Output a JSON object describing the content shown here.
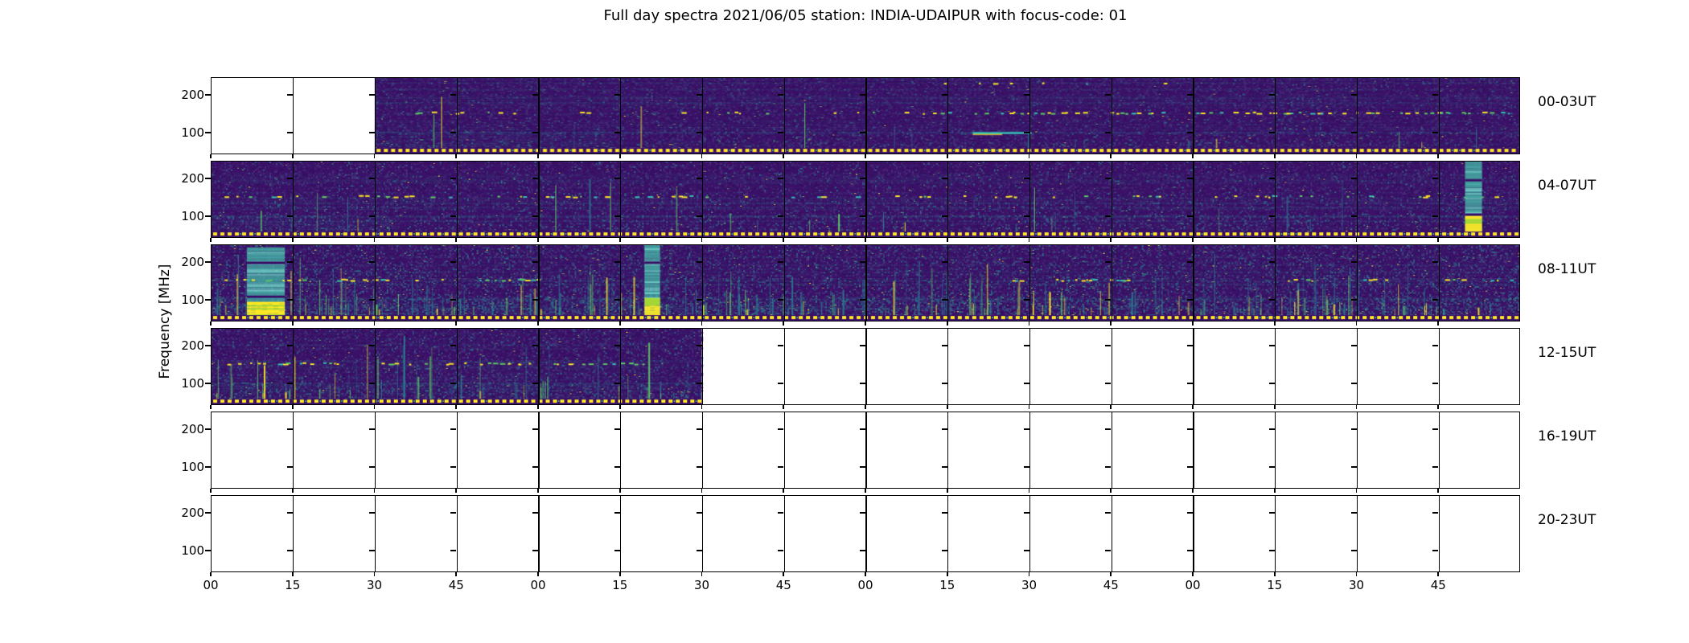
{
  "title": "Full day spectra 2021/06/05 station: INDIA-UDAIPUR with focus-code: 01",
  "ylabel": "Frequency [MHz]",
  "y_tick_labels": [
    "200",
    "100"
  ],
  "x_tick_labels": [
    "00",
    "15",
    "30",
    "45",
    "00",
    "15",
    "30",
    "45",
    "00",
    "15",
    "30",
    "45",
    "00",
    "15",
    "30",
    "45"
  ],
  "row_labels": [
    "00-03UT",
    "04-07UT",
    "08-11UT",
    "12-15UT",
    "16-19UT",
    "20-23UT"
  ],
  "chart_data": {
    "type": "heatmap",
    "subtype": "solar-radio-spectrogram",
    "title": "Full day spectra 2021/06/05 station: INDIA-UDAIPUR with focus-code: 01",
    "xlabel": "",
    "ylabel": "Frequency [MHz]",
    "colormap": "viridis",
    "y_ticks_mhz": [
      200,
      100
    ],
    "y_range_mhz_estimate": [
      45,
      255
    ],
    "panels_per_row": 16,
    "panel_minutes": 15,
    "x_tick_labels": [
      "00",
      "15",
      "30",
      "45",
      "00",
      "15",
      "30",
      "45",
      "00",
      "15",
      "30",
      "45",
      "00",
      "15",
      "30",
      "45"
    ],
    "legend": "none",
    "grid": "panel borders only",
    "colors": {
      "base": "#3b1069",
      "speckle_purple": "#46327e",
      "teal": "#2a788e",
      "bright_teal": "#35c0b5",
      "green": "#5ec962",
      "yellow": "#fde725",
      "band_teal": "#45a8a2",
      "band_light": "#6ccdc4",
      "green_yellow": "#addc30",
      "frame": "#000000",
      "empty": "#ffffff"
    },
    "rows": [
      {
        "label": "00-03UT",
        "fill_start_panel": 2,
        "fill_end_panel": 16,
        "noise": 0.035,
        "streaks": 15,
        "features": [
          {
            "type": "dash_line",
            "y": 0.455,
            "x0": 0.135,
            "x1": 0.53,
            "density": 0.22
          },
          {
            "type": "dash_line",
            "y": 0.455,
            "x0": 0.53,
            "x1": 0.995,
            "density": 0.55
          },
          {
            "type": "dash_line",
            "y": 0.06,
            "x0": 0.56,
            "x1": 0.74,
            "density": 0.15
          },
          {
            "type": "hline",
            "y": 0.715,
            "x0": 0.582,
            "x1": 0.627
          },
          {
            "type": "wash",
            "x0": 0.125,
            "x1": 0.3,
            "y0": 0.72,
            "y1": 0.95,
            "alpha": 0.22
          }
        ]
      },
      {
        "label": "04-07UT",
        "fill_start_panel": 0,
        "fill_end_panel": 16,
        "noise": 0.04,
        "streaks": 25,
        "features": [
          {
            "type": "dash_line",
            "y": 0.455,
            "x0": 0.01,
            "x1": 0.99,
            "density": 0.28
          },
          {
            "type": "vband",
            "x0": 0.9585,
            "x1": 0.9715,
            "y0": 0.0,
            "y1": 0.97,
            "ybot": 0.72
          },
          {
            "type": "wash",
            "x0": 0.0,
            "x1": 0.14,
            "y0": 0.74,
            "y1": 0.95,
            "alpha": 0.18
          }
        ]
      },
      {
        "label": "08-11UT",
        "fill_start_panel": 0,
        "fill_end_panel": 16,
        "noise": 0.1,
        "streaks": 260,
        "features": [
          {
            "type": "vband",
            "x0": 0.027,
            "x1": 0.056,
            "y0": 0.03,
            "y1": 0.97,
            "ybot": 0.75
          },
          {
            "type": "vband",
            "x0": 0.331,
            "x1": 0.343,
            "y0": 0.0,
            "y1": 0.97,
            "ybot": 0.7
          },
          {
            "type": "dash_line",
            "y": 0.455,
            "x0": 0.01,
            "x1": 0.25,
            "density": 0.5
          },
          {
            "type": "dash_line",
            "y": 0.455,
            "x0": 0.6,
            "x1": 0.7,
            "density": 0.6
          },
          {
            "type": "dash_line",
            "y": 0.455,
            "x0": 0.82,
            "x1": 0.9,
            "density": 0.5
          },
          {
            "type": "dash_line",
            "y": 0.455,
            "x0": 0.93,
            "x1": 0.995,
            "density": 0.35
          },
          {
            "type": "wash",
            "x0": 0.0,
            "x1": 0.5,
            "y0": 0.78,
            "y1": 0.96,
            "alpha": 0.2
          }
        ]
      },
      {
        "label": "12-15UT",
        "fill_start_panel": 0,
        "fill_end_panel": 6,
        "noise": 0.055,
        "streaks": 60,
        "features": [
          {
            "type": "dash_line",
            "y": 0.455,
            "x0": 0.005,
            "x1": 0.1,
            "density": 0.6
          },
          {
            "type": "dash_line",
            "y": 0.455,
            "x0": 0.13,
            "x1": 0.33,
            "density": 0.45
          },
          {
            "type": "wash",
            "x0": 0.0,
            "x1": 0.33,
            "y0": 0.74,
            "y1": 0.95,
            "alpha": 0.18
          }
        ]
      },
      {
        "label": "16-19UT",
        "fill_start_panel": 0,
        "fill_end_panel": 0,
        "noise": 0,
        "streaks": 0,
        "features": []
      },
      {
        "label": "20-23UT",
        "fill_start_panel": 0,
        "fill_end_panel": 0,
        "noise": 0,
        "streaks": 0,
        "features": []
      }
    ],
    "notable_events": [
      {
        "row": "00-03UT",
        "desc": "first two 15-min panels blank; bright narrowband emission near 100 MHz around 02:30"
      },
      {
        "row": "04-07UT",
        "desc": "strong broadband vertical burst near 07:50 with intense yellow low-frequency component"
      },
      {
        "row": "08-11UT",
        "desc": "broadband burst 08:05-08:15 and many short broadband spikes throughout"
      },
      {
        "row": "12-15UT",
        "desc": "data ends at 13:30; remaining panels blank"
      },
      {
        "row": "16-19UT",
        "desc": "no data"
      },
      {
        "row": "20-23UT",
        "desc": "no data"
      }
    ]
  }
}
